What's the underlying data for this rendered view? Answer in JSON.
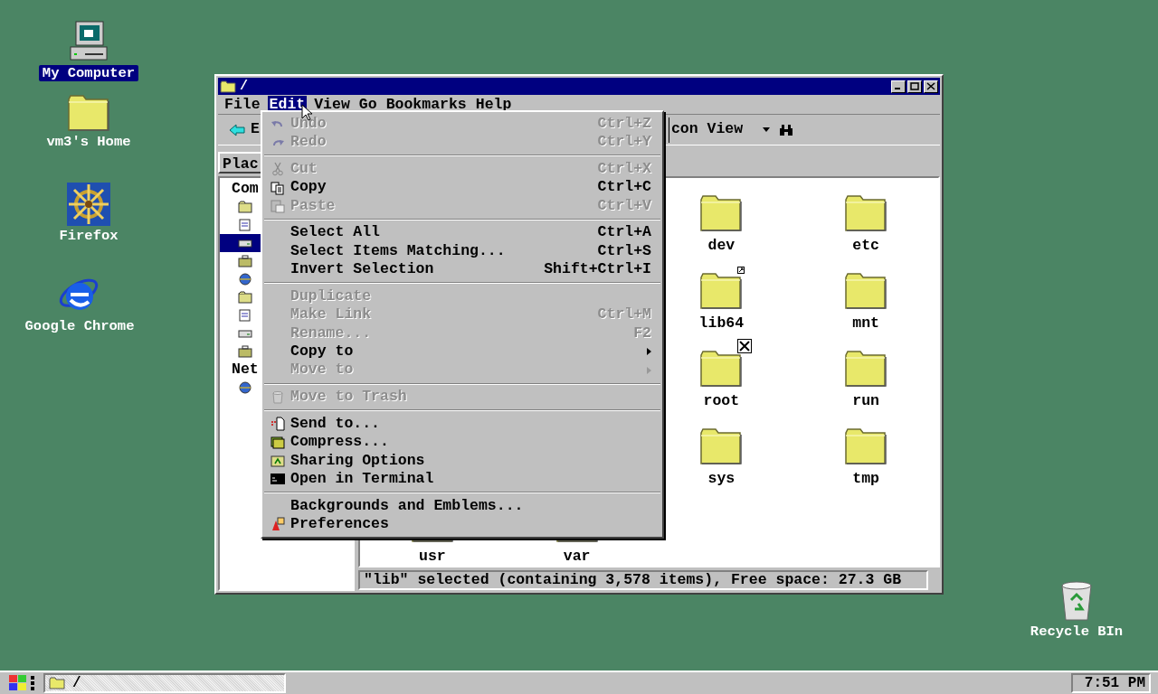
{
  "desktop_icons": [
    {
      "label": "My Computer",
      "selected": true
    },
    {
      "label": "vm3's Home",
      "selected": false
    },
    {
      "label": "Firefox",
      "selected": false
    },
    {
      "label": "Google Chrome",
      "selected": false
    },
    {
      "label": "Recycle BIn",
      "selected": false
    }
  ],
  "window": {
    "title": "/"
  },
  "menubar": [
    {
      "label": "File",
      "selected": false
    },
    {
      "label": "Edit",
      "selected": true
    },
    {
      "label": "View",
      "selected": false
    },
    {
      "label": "Go",
      "selected": false
    },
    {
      "label": "Bookmarks",
      "selected": false
    },
    {
      "label": "Help",
      "selected": false
    }
  ],
  "toolbar": {
    "back_label": "E",
    "view_mode": "con View"
  },
  "sidebar": {
    "tab": "Plac",
    "sections": [
      {
        "heading": "Com",
        "items": [
          {
            "selected": false
          },
          {
            "selected": false
          },
          {
            "selected": true
          },
          {
            "selected": false
          },
          {
            "selected": false
          },
          {
            "selected": false
          },
          {
            "selected": false
          },
          {
            "selected": false
          },
          {
            "selected": false
          }
        ]
      },
      {
        "heading": "Net",
        "items": [
          {
            "selected": false
          }
        ]
      }
    ]
  },
  "folders": [
    {
      "label": "dev",
      "kind": "folder"
    },
    {
      "label": "etc",
      "kind": "folder"
    },
    {
      "label": "lib64",
      "kind": "link"
    },
    {
      "label": "mnt",
      "kind": "folder"
    },
    {
      "label": "root",
      "kind": "locked"
    },
    {
      "label": "run",
      "kind": "folder"
    },
    {
      "label": "sys",
      "kind": "folder"
    },
    {
      "label": "tmp",
      "kind": "folder"
    },
    {
      "label": "usr",
      "kind": "folder"
    },
    {
      "label": "var",
      "kind": "folder"
    }
  ],
  "status_bar": "\"lib\" selected (containing 3,578 items), Free space: 27.3 GB",
  "edit_menu": [
    {
      "kind": "item",
      "label": "Undo",
      "shortcut": "Ctrl+Z",
      "disabled": true,
      "submenu": false
    },
    {
      "kind": "item",
      "label": "Redo",
      "shortcut": "Ctrl+Y",
      "disabled": true,
      "submenu": false
    },
    {
      "kind": "separator"
    },
    {
      "kind": "item",
      "label": "Cut",
      "shortcut": "Ctrl+X",
      "disabled": true,
      "submenu": false
    },
    {
      "kind": "item",
      "label": "Copy",
      "shortcut": "Ctrl+C",
      "disabled": false,
      "submenu": false
    },
    {
      "kind": "item",
      "label": "Paste",
      "shortcut": "Ctrl+V",
      "disabled": true,
      "submenu": false
    },
    {
      "kind": "separator"
    },
    {
      "kind": "item",
      "label": "Select All",
      "shortcut": "Ctrl+A",
      "disabled": false,
      "submenu": false
    },
    {
      "kind": "item",
      "label": "Select Items Matching...",
      "shortcut": "Ctrl+S",
      "disabled": false,
      "submenu": false
    },
    {
      "kind": "item",
      "label": "Invert Selection",
      "shortcut": "Shift+Ctrl+I",
      "disabled": false,
      "submenu": false
    },
    {
      "kind": "separator"
    },
    {
      "kind": "item",
      "label": "Duplicate",
      "disabled": true,
      "submenu": false
    },
    {
      "kind": "item",
      "label": "Make Link",
      "shortcut": "Ctrl+M",
      "disabled": true,
      "submenu": false
    },
    {
      "kind": "item",
      "label": "Rename...",
      "shortcut": "F2",
      "disabled": true,
      "submenu": false
    },
    {
      "kind": "item",
      "label": "Copy to",
      "disabled": false,
      "submenu": true
    },
    {
      "kind": "item",
      "label": "Move to",
      "disabled": true,
      "submenu": true
    },
    {
      "kind": "separator"
    },
    {
      "kind": "item",
      "label": "Move to Trash",
      "disabled": true,
      "submenu": false
    },
    {
      "kind": "separator"
    },
    {
      "kind": "item",
      "label": "Send to...",
      "disabled": false,
      "submenu": false
    },
    {
      "kind": "item",
      "label": "Compress...",
      "disabled": false,
      "submenu": false
    },
    {
      "kind": "item",
      "label": "Sharing Options",
      "disabled": false,
      "submenu": false
    },
    {
      "kind": "item",
      "label": "Open in Terminal",
      "disabled": false,
      "submenu": false
    },
    {
      "kind": "separator"
    },
    {
      "kind": "item",
      "label": "Backgrounds and Emblems...",
      "disabled": false,
      "submenu": false
    },
    {
      "kind": "item",
      "label": "Preferences",
      "disabled": false,
      "submenu": false
    }
  ],
  "taskbar": {
    "task": "/",
    "clock": "7:51 PM"
  }
}
